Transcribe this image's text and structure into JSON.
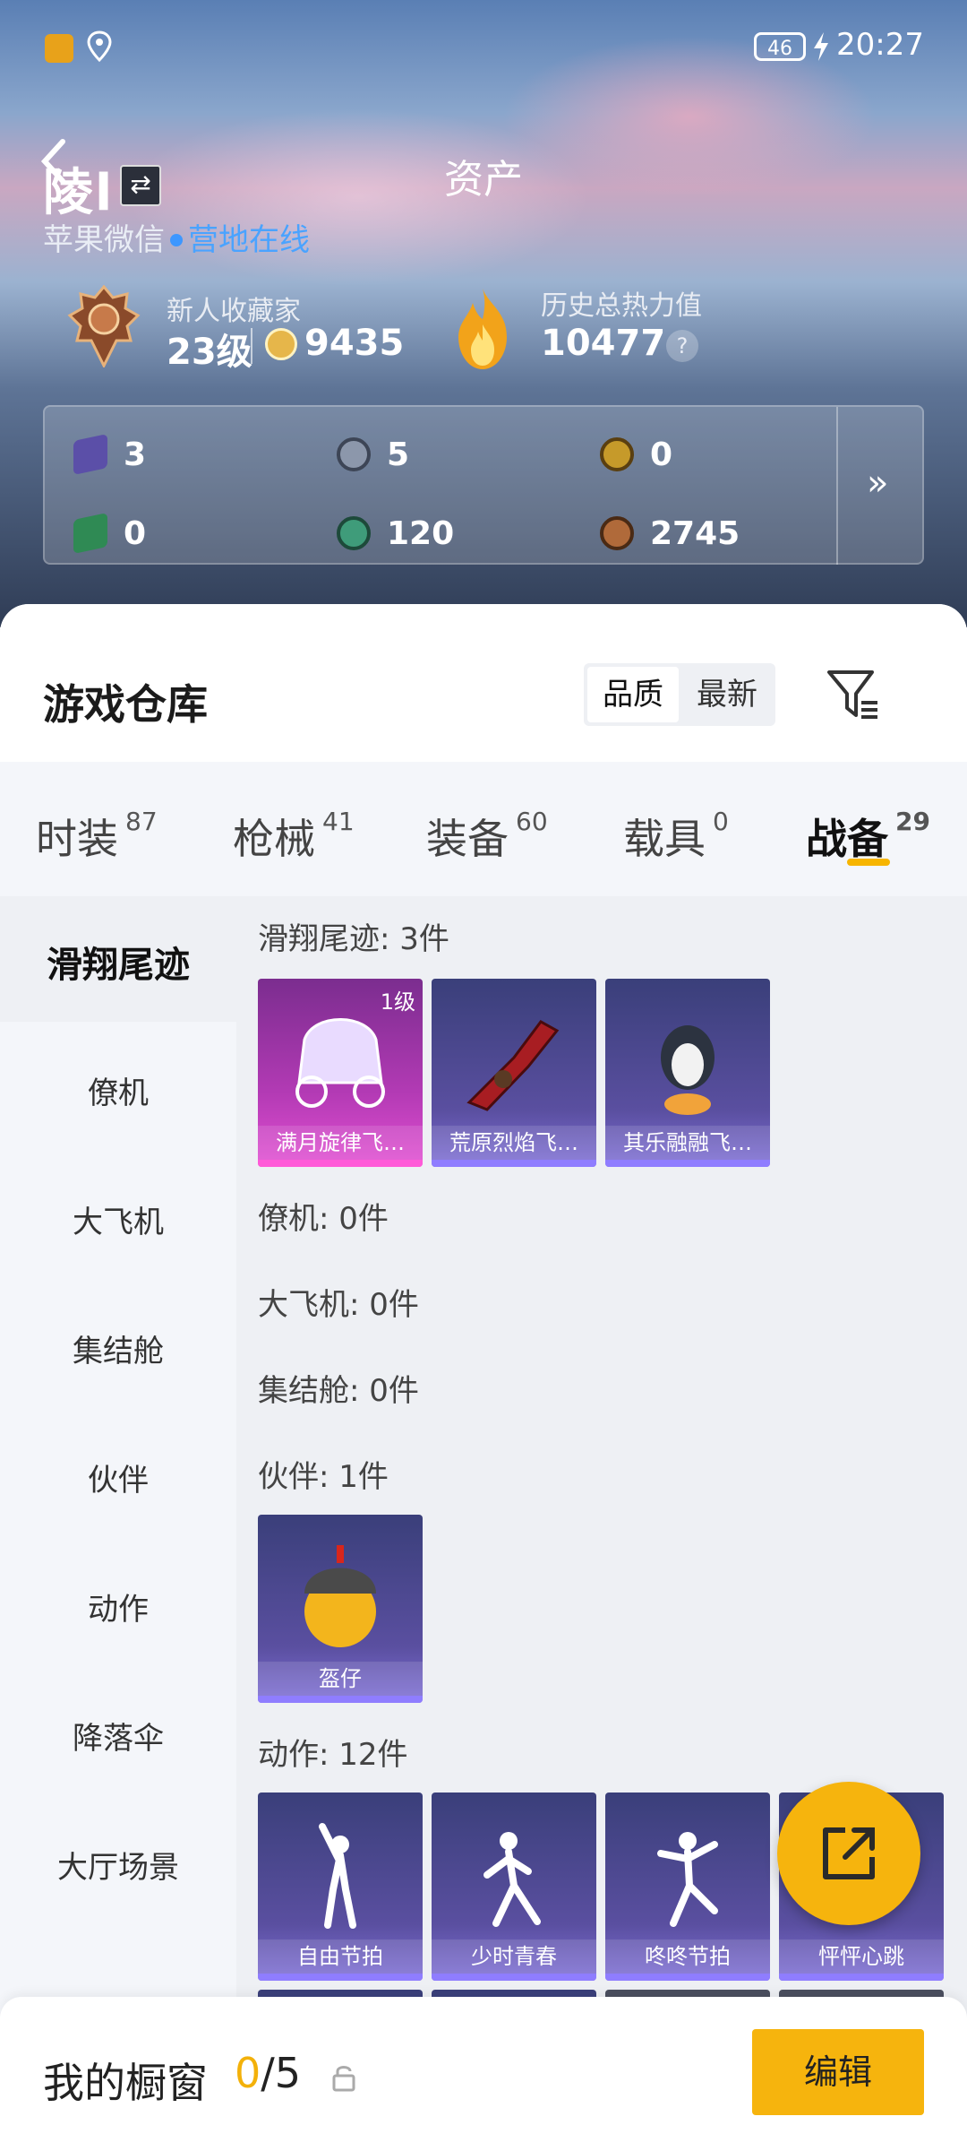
{
  "status": {
    "battery": "46",
    "time": "20:27"
  },
  "header": {
    "title": "资产",
    "nickname": "陵l",
    "account": "苹果微信",
    "online": "营地在线"
  },
  "profile": {
    "rank_title": "新人收藏家",
    "rank_level": "23级",
    "coins": "9435",
    "heat_title": "历史总热力值",
    "heat_value": "10477",
    "help_label": "?"
  },
  "currencies": [
    {
      "icon": "purple-card-icon",
      "value": "3",
      "color": "#5b4fa8"
    },
    {
      "icon": "silver-coin-icon",
      "value": "5",
      "color": "#8c97ab"
    },
    {
      "icon": "gold-token-icon",
      "value": "0",
      "color": "#c69a2a"
    },
    {
      "icon": "green-card-icon",
      "value": "0",
      "color": "#2f8a54"
    },
    {
      "icon": "green-coin-icon",
      "value": "120",
      "color": "#3f9c7a"
    },
    {
      "icon": "bronze-coin-icon",
      "value": "2745",
      "color": "#b06a3a"
    }
  ],
  "currency_more": "»",
  "warehouse": {
    "title": "游戏仓库",
    "sort_quality": "品质",
    "sort_newest": "最新"
  },
  "tabs": [
    {
      "label": "时装",
      "count": "87"
    },
    {
      "label": "枪械",
      "count": "41"
    },
    {
      "label": "装备",
      "count": "60"
    },
    {
      "label": "载具",
      "count": "0"
    },
    {
      "label": "战备",
      "count": "29"
    }
  ],
  "sidebar": {
    "active": "滑翔尾迹",
    "items": [
      "僚机",
      "大飞机",
      "集结舱",
      "伙伴",
      "动作",
      "降落伞",
      "大厅场景"
    ]
  },
  "sections": {
    "trail": {
      "title": "滑翔尾迹: 3件",
      "items": [
        "满月旋律飞…",
        "荒原烈焰飞…",
        "其乐融融飞…"
      ],
      "badge": "1级"
    },
    "wingman": {
      "title": "僚机: 0件"
    },
    "plane": {
      "title": "大飞机: 0件"
    },
    "pod": {
      "title": "集结舱: 0件"
    },
    "companion": {
      "title": "伙伴: 1件",
      "items": [
        "盔仔"
      ]
    },
    "emote": {
      "title": "动作: 12件",
      "items": [
        "自由节拍",
        "少时青春",
        "咚咚节拍",
        "怦怦心跳"
      ]
    }
  },
  "bottom": {
    "label": "我的橱窗",
    "count_used": "0",
    "count_total": "/5",
    "edit": "编辑"
  },
  "colors": {
    "accent": "#f6b40d",
    "link": "#4aa3ff"
  }
}
